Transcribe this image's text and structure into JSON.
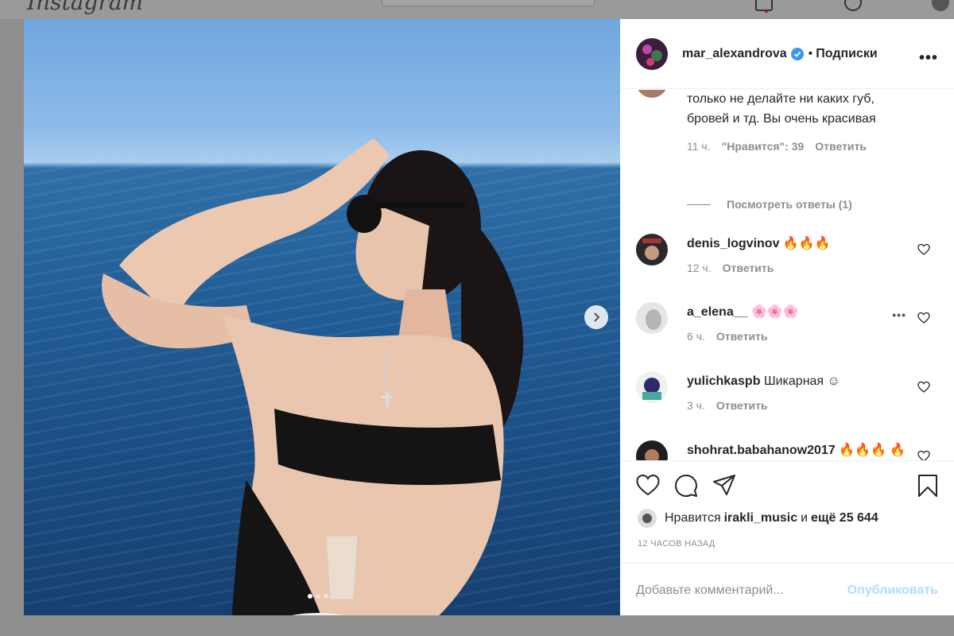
{
  "app": {
    "logo_text": "Instagram"
  },
  "post": {
    "author": "mar_alexandrova",
    "dot": "•",
    "follow_label": "Подписки",
    "likes_prefix": "Нравится",
    "likes_user": "irakli_music",
    "likes_and": "и",
    "likes_more": "ещё 25 644",
    "time_ago": "12 ЧАСОВ НАЗАД",
    "carousel_count": 3,
    "carousel_active": 1
  },
  "comments": [
    {
      "user": "",
      "text": "Идеальная Марина, пожалуйста, только не делайте ни каких губ, бровей и тд. Вы очень красивая",
      "time": "11 ч.",
      "likes": "\"Нравится\": 39",
      "reply": "Ответить",
      "view_replies": "Посмотреть ответы (1)"
    },
    {
      "user": "denis_logvinov",
      "text": "🔥🔥🔥",
      "time": "12 ч.",
      "reply": "Ответить"
    },
    {
      "user": "a_elena__",
      "text": "🌸🌸🌸",
      "time": "6 ч.",
      "reply": "Ответить"
    },
    {
      "user": "yulichkaspb",
      "text": "Шикарная ☺",
      "time": "3 ч.",
      "reply": "Ответить"
    },
    {
      "user": "shohrat.babahanow2017",
      "text": "🔥🔥🔥 🔥🔥🔥🔥🔥",
      "time": "",
      "reply": ""
    }
  ],
  "add_comment": {
    "placeholder": "Добавьте комментарий...",
    "publish_label": "Опубликовать"
  },
  "colors": {
    "accent_disabled": "#b3dbff",
    "verified": "#3897f0",
    "text": "#262626",
    "muted": "#8e8e8e"
  }
}
